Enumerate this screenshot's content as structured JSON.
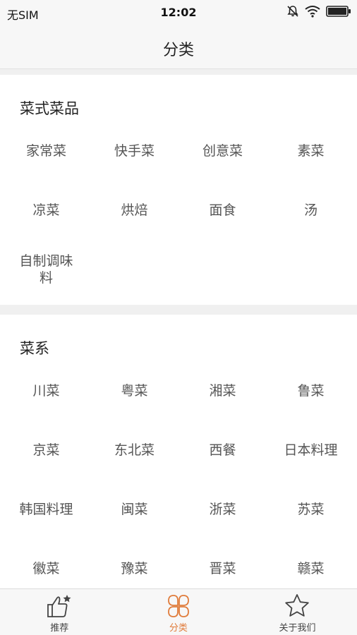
{
  "status_bar": {
    "carrier": "无SIM",
    "time": "12:02"
  },
  "nav": {
    "title": "分类"
  },
  "sections": [
    {
      "title": "菜式菜品",
      "items": [
        {
          "label": "家常菜"
        },
        {
          "label": "快手菜"
        },
        {
          "label": "创意菜"
        },
        {
          "label": "素菜"
        },
        {
          "label": "凉菜"
        },
        {
          "label": "烘焙"
        },
        {
          "label": "面食"
        },
        {
          "label": "汤"
        },
        {
          "label": "自制调味料"
        }
      ]
    },
    {
      "title": "菜系",
      "items": [
        {
          "label": "川菜"
        },
        {
          "label": "粤菜"
        },
        {
          "label": "湘菜"
        },
        {
          "label": "鲁菜"
        },
        {
          "label": "京菜"
        },
        {
          "label": "东北菜"
        },
        {
          "label": "西餐"
        },
        {
          "label": "日本料理"
        },
        {
          "label": "韩国料理"
        },
        {
          "label": "闽菜"
        },
        {
          "label": "浙菜"
        },
        {
          "label": "苏菜"
        },
        {
          "label": "徽菜"
        },
        {
          "label": "豫菜"
        },
        {
          "label": "晋菜"
        },
        {
          "label": "赣菜"
        }
      ]
    }
  ],
  "tabbar": {
    "tabs": [
      {
        "label": "推荐",
        "icon": "thumbs-up-star-icon",
        "active": false
      },
      {
        "label": "分类",
        "icon": "clover-icon",
        "active": true
      },
      {
        "label": "关于我们",
        "icon": "star-outline-icon",
        "active": false
      }
    ]
  },
  "colors": {
    "accent": "#e07b3a",
    "background": "#f0f0f0",
    "bar": "#f7f7f7"
  }
}
